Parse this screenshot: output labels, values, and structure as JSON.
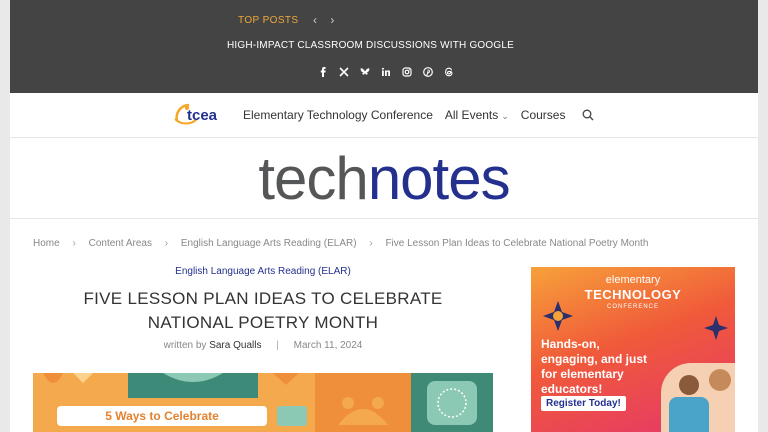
{
  "topbar": {
    "label": "TOP POSTS",
    "prev_arrow": "‹",
    "next_arrow": "›",
    "headline": "HIGH-IMPACT CLASSROOM DISCUSSIONS WITH GOOGLE",
    "socials": [
      "facebook-icon",
      "x-icon",
      "bluesky-icon",
      "linkedin-icon",
      "instagram-icon",
      "pinterest-icon",
      "threads-icon"
    ]
  },
  "nav": {
    "logo_text": "tcea",
    "items": [
      {
        "label": "Elementary Technology Conference"
      },
      {
        "label": "All Events",
        "has_dropdown": true
      },
      {
        "label": "Courses"
      }
    ],
    "dropdown_glyph": "⌄"
  },
  "masthead": {
    "brand_part1": "tech",
    "brand_part2": "notes",
    "colors": {
      "tech": "#555658",
      "notes": "#23308e"
    }
  },
  "breadcrumb": {
    "items": [
      "Home",
      "Content Areas",
      "English Language Arts Reading (ELAR)",
      "Five Lesson Plan Ideas to Celebrate National Poetry Month"
    ],
    "separator": "›"
  },
  "article": {
    "category": "English Language Arts Reading (ELAR)",
    "title_line1": "FIVE LESSON PLAN IDEAS TO CELEBRATE",
    "title_line2": "NATIONAL POETRY MONTH",
    "written_by": "written by",
    "author": "Sara Qualls",
    "date": "March 11, 2024",
    "hero_text": "5 Ways to Celebrate"
  },
  "ad": {
    "kicker": "elementary",
    "title": "TECHNOLOGY",
    "sub": "CONFERENCE",
    "body": "Hands-on, engaging, and just for elementary educators!",
    "cta": "Register Today!"
  }
}
